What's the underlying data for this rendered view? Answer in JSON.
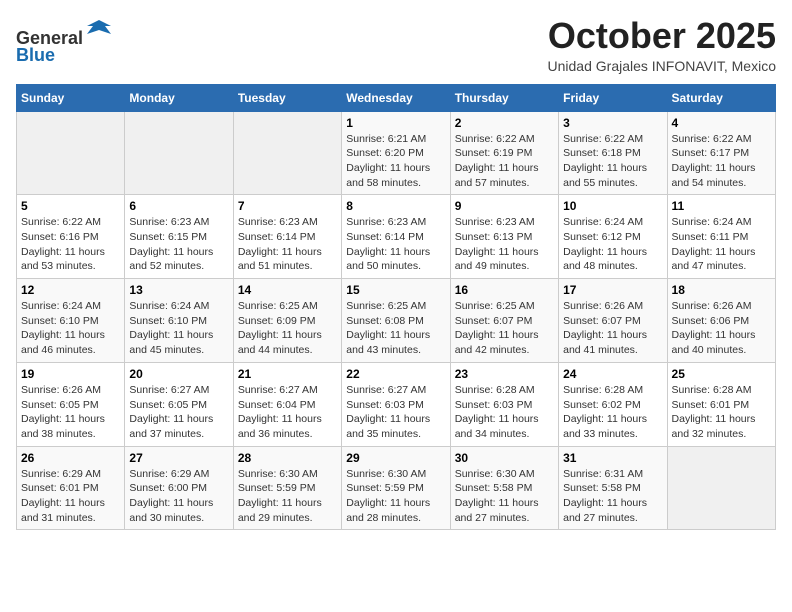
{
  "header": {
    "logo_line1": "General",
    "logo_line2": "Blue",
    "month": "October 2025",
    "location": "Unidad Grajales INFONAVIT, Mexico"
  },
  "weekdays": [
    "Sunday",
    "Monday",
    "Tuesday",
    "Wednesday",
    "Thursday",
    "Friday",
    "Saturday"
  ],
  "weeks": [
    [
      {
        "day": "",
        "info": ""
      },
      {
        "day": "",
        "info": ""
      },
      {
        "day": "",
        "info": ""
      },
      {
        "day": "1",
        "info": "Sunrise: 6:21 AM\nSunset: 6:20 PM\nDaylight: 11 hours and 58 minutes."
      },
      {
        "day": "2",
        "info": "Sunrise: 6:22 AM\nSunset: 6:19 PM\nDaylight: 11 hours and 57 minutes."
      },
      {
        "day": "3",
        "info": "Sunrise: 6:22 AM\nSunset: 6:18 PM\nDaylight: 11 hours and 55 minutes."
      },
      {
        "day": "4",
        "info": "Sunrise: 6:22 AM\nSunset: 6:17 PM\nDaylight: 11 hours and 54 minutes."
      }
    ],
    [
      {
        "day": "5",
        "info": "Sunrise: 6:22 AM\nSunset: 6:16 PM\nDaylight: 11 hours and 53 minutes."
      },
      {
        "day": "6",
        "info": "Sunrise: 6:23 AM\nSunset: 6:15 PM\nDaylight: 11 hours and 52 minutes."
      },
      {
        "day": "7",
        "info": "Sunrise: 6:23 AM\nSunset: 6:14 PM\nDaylight: 11 hours and 51 minutes."
      },
      {
        "day": "8",
        "info": "Sunrise: 6:23 AM\nSunset: 6:14 PM\nDaylight: 11 hours and 50 minutes."
      },
      {
        "day": "9",
        "info": "Sunrise: 6:23 AM\nSunset: 6:13 PM\nDaylight: 11 hours and 49 minutes."
      },
      {
        "day": "10",
        "info": "Sunrise: 6:24 AM\nSunset: 6:12 PM\nDaylight: 11 hours and 48 minutes."
      },
      {
        "day": "11",
        "info": "Sunrise: 6:24 AM\nSunset: 6:11 PM\nDaylight: 11 hours and 47 minutes."
      }
    ],
    [
      {
        "day": "12",
        "info": "Sunrise: 6:24 AM\nSunset: 6:10 PM\nDaylight: 11 hours and 46 minutes."
      },
      {
        "day": "13",
        "info": "Sunrise: 6:24 AM\nSunset: 6:10 PM\nDaylight: 11 hours and 45 minutes."
      },
      {
        "day": "14",
        "info": "Sunrise: 6:25 AM\nSunset: 6:09 PM\nDaylight: 11 hours and 44 minutes."
      },
      {
        "day": "15",
        "info": "Sunrise: 6:25 AM\nSunset: 6:08 PM\nDaylight: 11 hours and 43 minutes."
      },
      {
        "day": "16",
        "info": "Sunrise: 6:25 AM\nSunset: 6:07 PM\nDaylight: 11 hours and 42 minutes."
      },
      {
        "day": "17",
        "info": "Sunrise: 6:26 AM\nSunset: 6:07 PM\nDaylight: 11 hours and 41 minutes."
      },
      {
        "day": "18",
        "info": "Sunrise: 6:26 AM\nSunset: 6:06 PM\nDaylight: 11 hours and 40 minutes."
      }
    ],
    [
      {
        "day": "19",
        "info": "Sunrise: 6:26 AM\nSunset: 6:05 PM\nDaylight: 11 hours and 38 minutes."
      },
      {
        "day": "20",
        "info": "Sunrise: 6:27 AM\nSunset: 6:05 PM\nDaylight: 11 hours and 37 minutes."
      },
      {
        "day": "21",
        "info": "Sunrise: 6:27 AM\nSunset: 6:04 PM\nDaylight: 11 hours and 36 minutes."
      },
      {
        "day": "22",
        "info": "Sunrise: 6:27 AM\nSunset: 6:03 PM\nDaylight: 11 hours and 35 minutes."
      },
      {
        "day": "23",
        "info": "Sunrise: 6:28 AM\nSunset: 6:03 PM\nDaylight: 11 hours and 34 minutes."
      },
      {
        "day": "24",
        "info": "Sunrise: 6:28 AM\nSunset: 6:02 PM\nDaylight: 11 hours and 33 minutes."
      },
      {
        "day": "25",
        "info": "Sunrise: 6:28 AM\nSunset: 6:01 PM\nDaylight: 11 hours and 32 minutes."
      }
    ],
    [
      {
        "day": "26",
        "info": "Sunrise: 6:29 AM\nSunset: 6:01 PM\nDaylight: 11 hours and 31 minutes."
      },
      {
        "day": "27",
        "info": "Sunrise: 6:29 AM\nSunset: 6:00 PM\nDaylight: 11 hours and 30 minutes."
      },
      {
        "day": "28",
        "info": "Sunrise: 6:30 AM\nSunset: 5:59 PM\nDaylight: 11 hours and 29 minutes."
      },
      {
        "day": "29",
        "info": "Sunrise: 6:30 AM\nSunset: 5:59 PM\nDaylight: 11 hours and 28 minutes."
      },
      {
        "day": "30",
        "info": "Sunrise: 6:30 AM\nSunset: 5:58 PM\nDaylight: 11 hours and 27 minutes."
      },
      {
        "day": "31",
        "info": "Sunrise: 6:31 AM\nSunset: 5:58 PM\nDaylight: 11 hours and 27 minutes."
      },
      {
        "day": "",
        "info": ""
      }
    ]
  ]
}
